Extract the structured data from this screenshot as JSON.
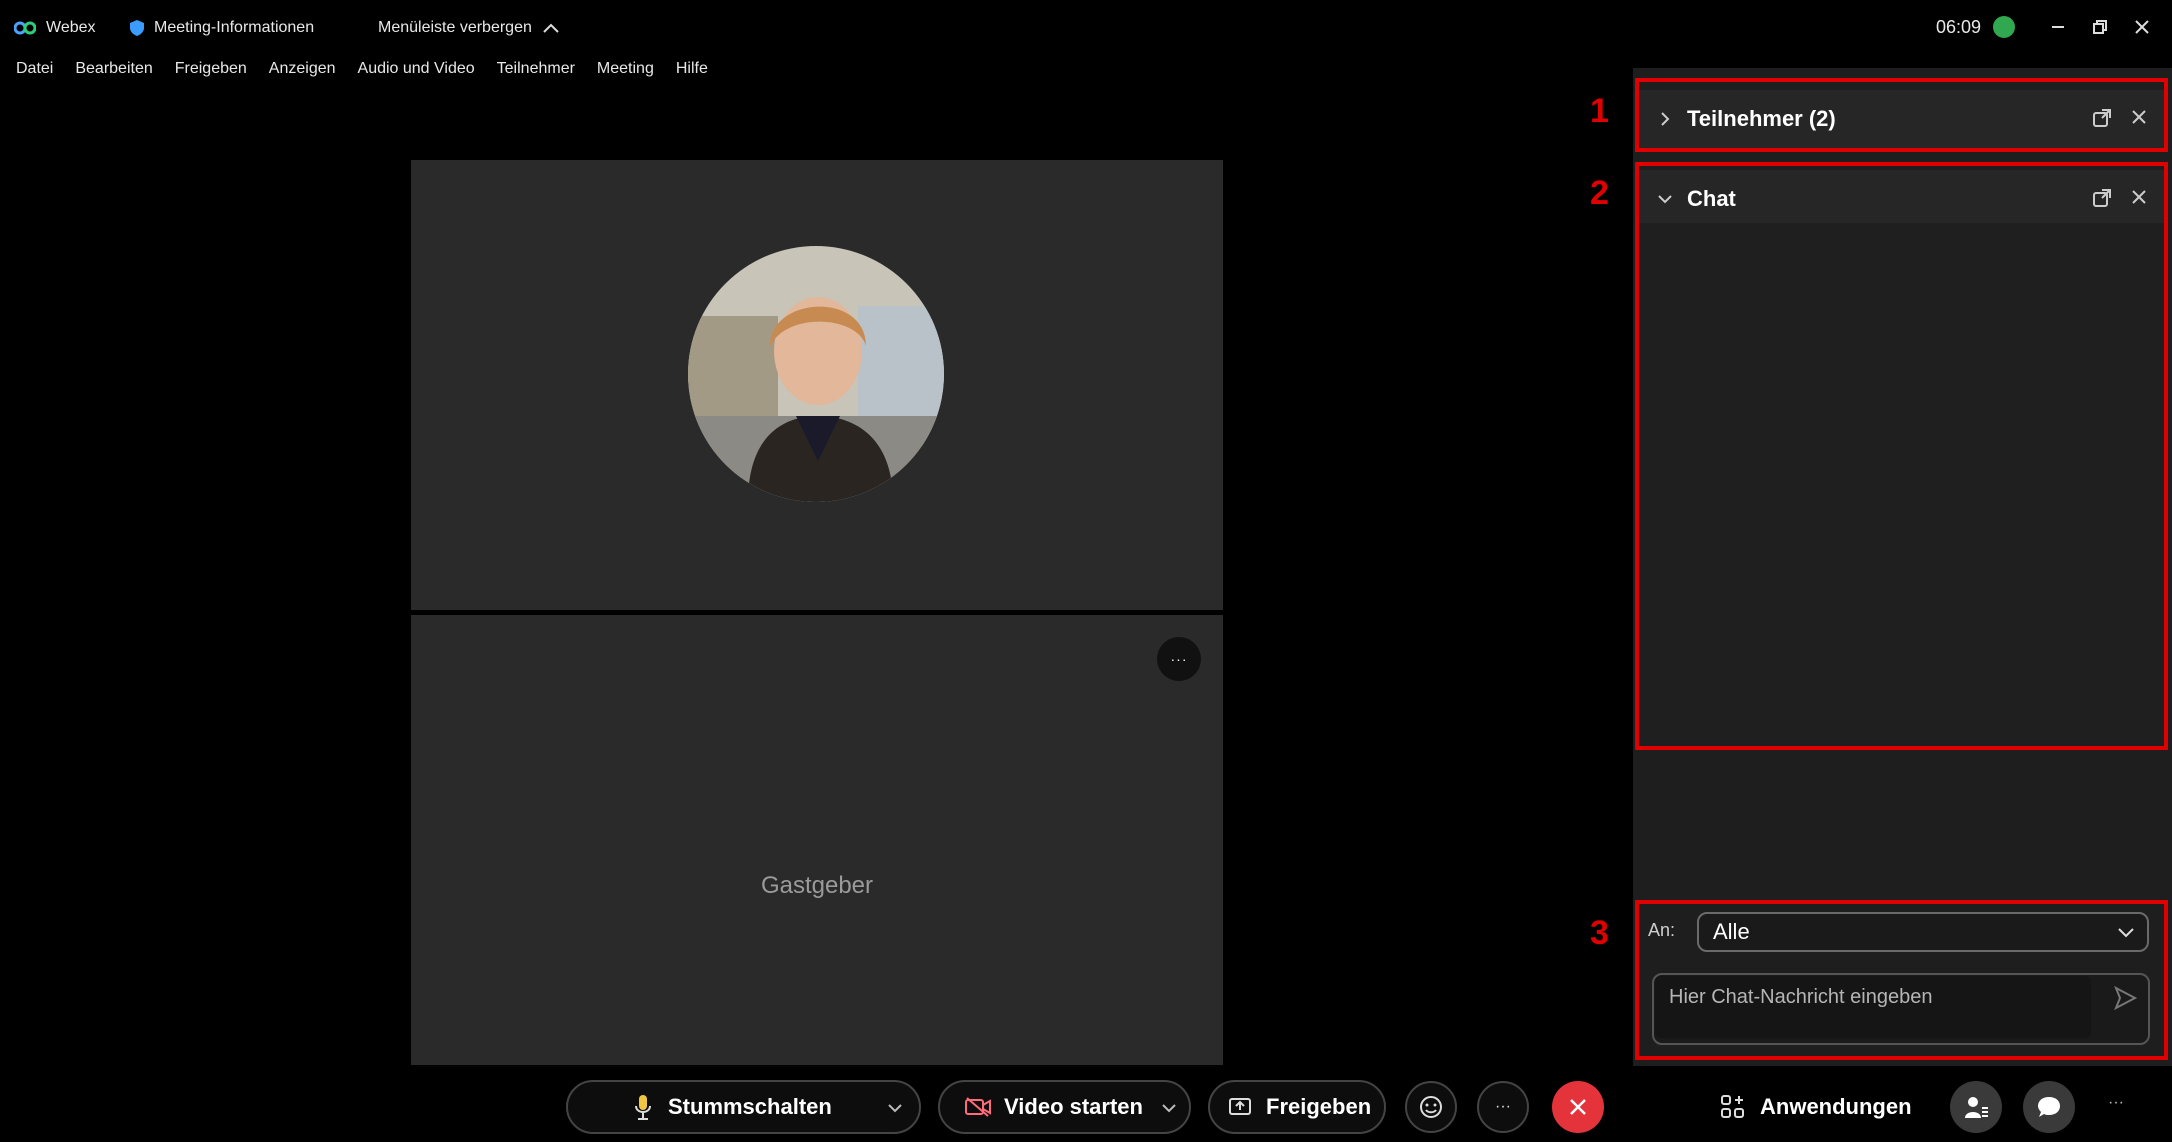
{
  "titlebar": {
    "app_name": "Webex",
    "meeting_info": "Meeting-Informationen",
    "hide_menu": "Menüleiste verbergen",
    "clock": "06:09"
  },
  "menu": {
    "items": [
      "Datei",
      "Bearbeiten",
      "Freigeben",
      "Anzeigen",
      "Audio und Video",
      "Teilnehmer",
      "Meeting",
      "Hilfe"
    ]
  },
  "video": {
    "host_label": "Gastgeber",
    "more_label": "···"
  },
  "panels": {
    "participants_title": "Teilnehmer (2)",
    "chat_title": "Chat",
    "to_label": "An:",
    "to_value": "Alle",
    "chat_placeholder": "Hier Chat-Nachricht eingeben"
  },
  "annotations": {
    "box1": "1",
    "box2": "2",
    "box3": "3"
  },
  "toolbar": {
    "mute_label": "Stummschalten",
    "video_label": "Video starten",
    "share_label": "Freigeben",
    "more_label": "···",
    "apps_label": "Anwendungen",
    "overflow_label": "···"
  },
  "colors": {
    "accent_red": "#e00000",
    "leave_red": "#e5333b",
    "status_green": "#2fa84f"
  }
}
